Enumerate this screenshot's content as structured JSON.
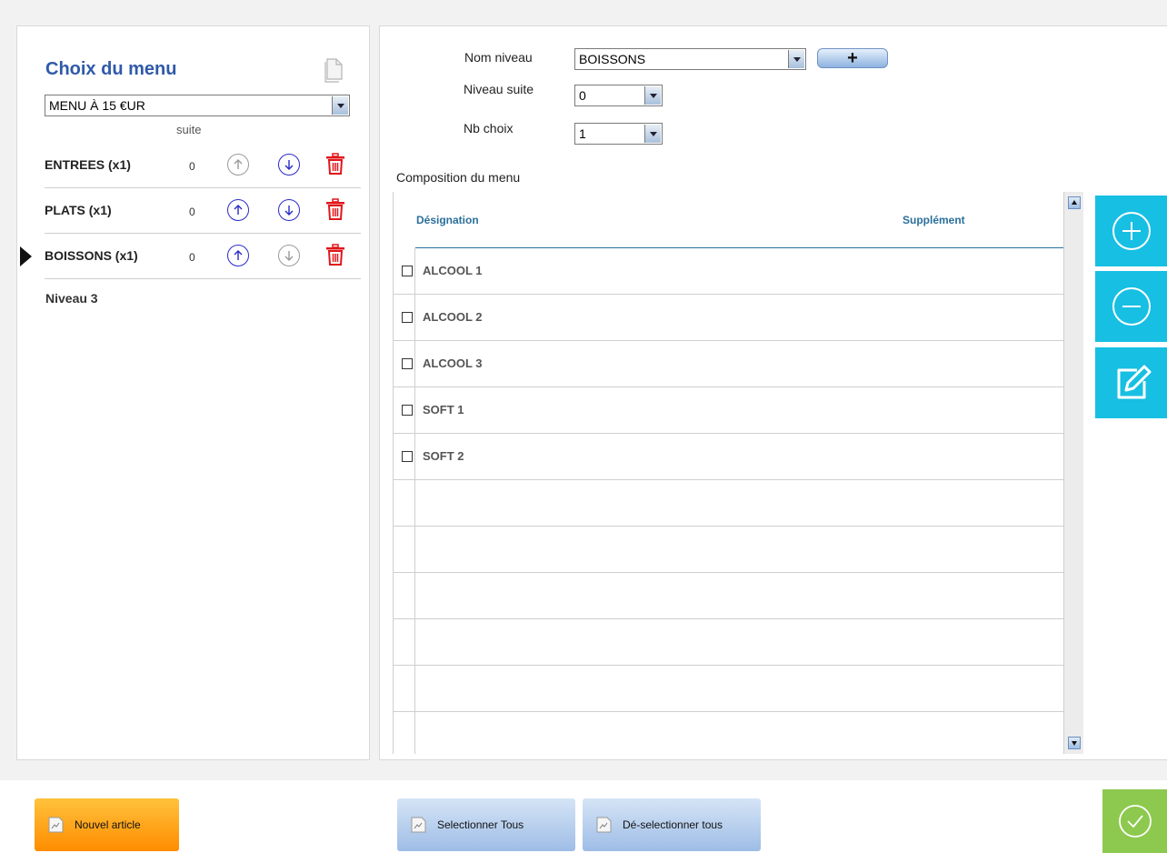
{
  "menu_panel": {
    "title": "Choix du menu",
    "selected_menu": "MENU À 15 €UR",
    "suite_header": "suite",
    "levels": [
      {
        "label": "ENTREES (x1)",
        "suite": "0",
        "up_enabled": false,
        "down_enabled": true
      },
      {
        "label": "PLATS (x1)",
        "suite": "0",
        "up_enabled": true,
        "down_enabled": true
      },
      {
        "label": "BOISSONS (x1)",
        "suite": "0",
        "up_enabled": true,
        "down_enabled": false,
        "selected": true
      }
    ],
    "new_level_label": "Niveau 3"
  },
  "level_form": {
    "nom_niveau_label": "Nom niveau",
    "nom_niveau_value": "BOISSONS",
    "add_button_label": "+",
    "niveau_suite_label": "Niveau suite",
    "niveau_suite_value": "0",
    "nb_choix_label": "Nb choix",
    "nb_choix_value": "1"
  },
  "composition": {
    "title": "Composition du menu",
    "columns": {
      "designation": "Désignation",
      "supplement": "Supplément"
    },
    "rows": [
      {
        "name": "ALCOOL 1",
        "checked": false
      },
      {
        "name": "ALCOOL 2",
        "checked": false
      },
      {
        "name": "ALCOOL 3",
        "checked": false
      },
      {
        "name": "SOFT 1",
        "checked": false
      },
      {
        "name": "SOFT 2",
        "checked": false
      },
      {
        "name": "",
        "checked": false
      },
      {
        "name": "",
        "checked": false
      },
      {
        "name": "",
        "checked": false
      },
      {
        "name": "",
        "checked": false
      },
      {
        "name": "",
        "checked": false
      },
      {
        "name": "",
        "checked": false
      }
    ]
  },
  "footer": {
    "new_article": "Nouvel article",
    "select_all": "Selectionner Tous",
    "deselect_all": "Dé-selectionner tous"
  },
  "colors": {
    "accent": "#17bfe3",
    "title_blue": "#2f5aa8",
    "header_blue": "#2a6f9a",
    "delete_red": "#e0161b",
    "ok_green": "#8dc94e",
    "orange": "#ff8c00"
  }
}
